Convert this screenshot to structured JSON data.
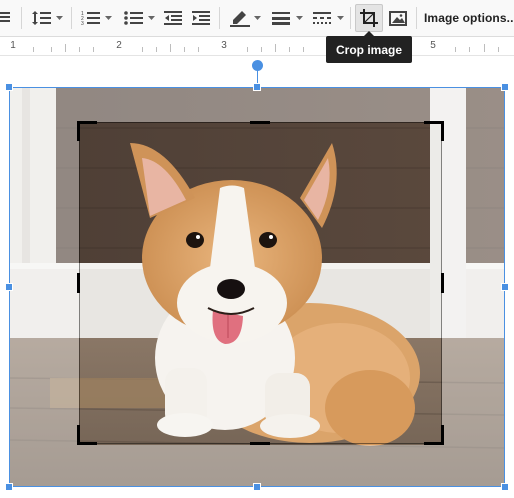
{
  "toolbar": {
    "items": [
      {
        "name": "align-justify-icon"
      },
      {
        "name": "line-spacing-icon"
      },
      {
        "name": "numbered-list-icon"
      },
      {
        "name": "bulleted-list-icon"
      },
      {
        "name": "decrease-indent-icon"
      },
      {
        "name": "increase-indent-icon"
      },
      {
        "name": "border-color-pen-icon"
      },
      {
        "name": "border-weight-icon"
      },
      {
        "name": "border-dash-icon"
      },
      {
        "name": "crop-icon"
      },
      {
        "name": "reset-image-icon"
      }
    ],
    "image_options_label": "Image options..",
    "crop_active": true
  },
  "tooltip": {
    "text": "Crop image"
  },
  "ruler": {
    "labels": [
      "1",
      "2",
      "3",
      "5"
    ]
  },
  "image": {
    "subject": "corgi puppy"
  },
  "colors": {
    "accent": "#4a90e2",
    "toolbar_bg": "#f9f9f9",
    "tooltip_bg": "#222222"
  }
}
